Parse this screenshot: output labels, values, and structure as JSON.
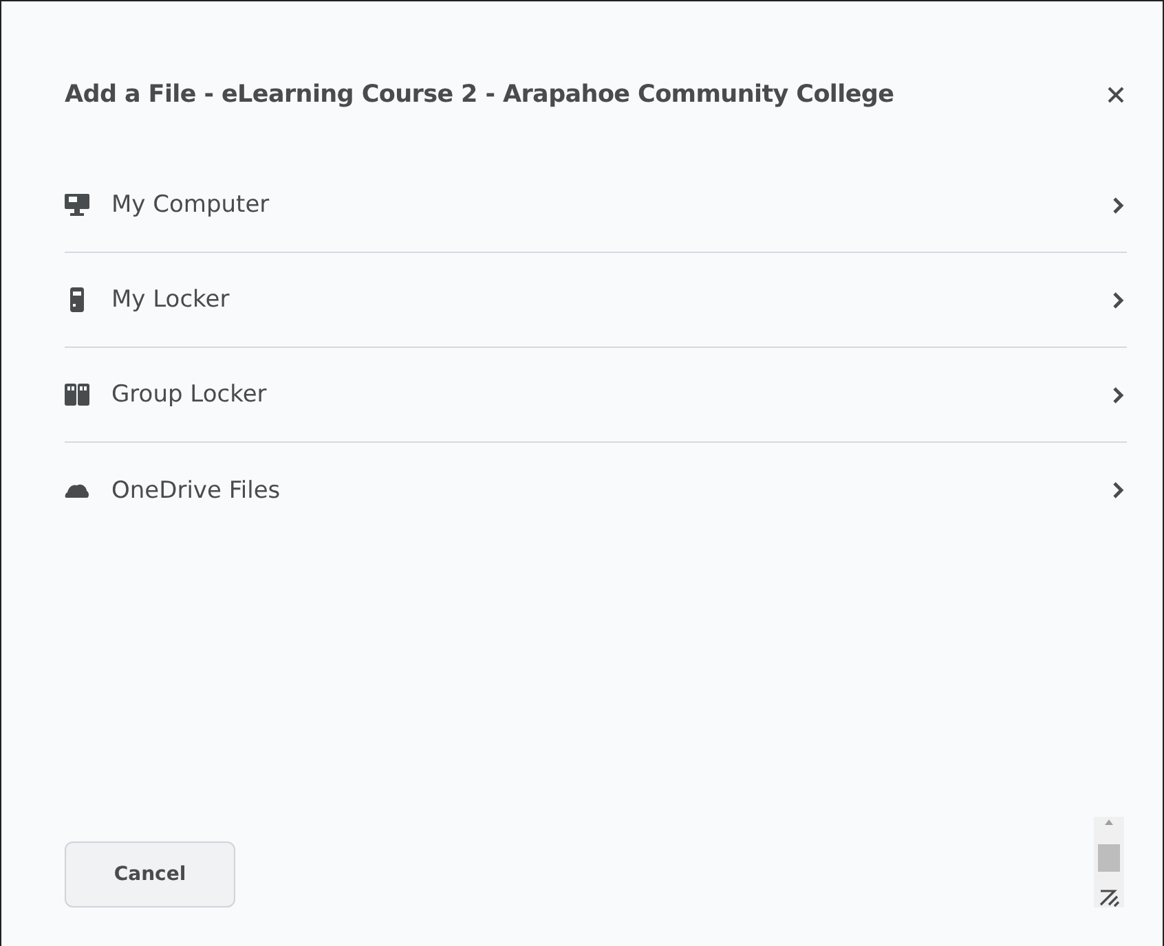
{
  "dialog": {
    "title": "Add a File - eLearning Course 2 - Arapahoe Community College"
  },
  "sources": [
    {
      "kind": "computer",
      "label": "My Computer"
    },
    {
      "kind": "locker",
      "label": "My Locker"
    },
    {
      "kind": "group-locker",
      "label": "Group Locker"
    },
    {
      "kind": "cloud",
      "label": "OneDrive Files"
    }
  ],
  "buttons": [
    "Cancel"
  ]
}
